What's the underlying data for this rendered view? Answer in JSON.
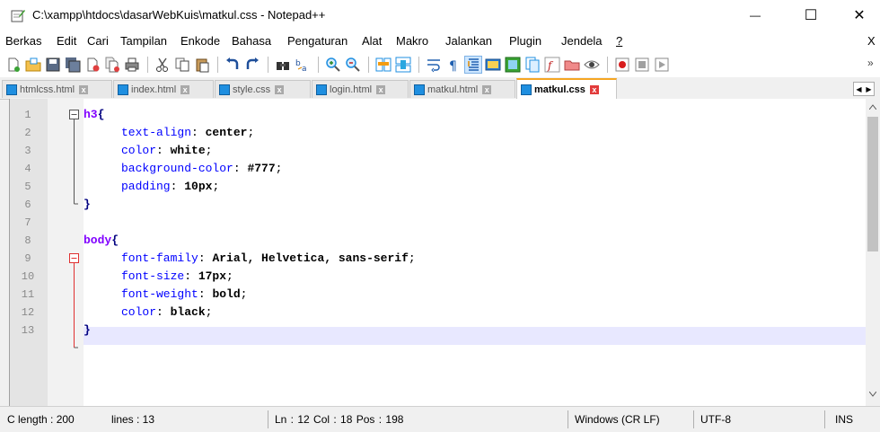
{
  "window": {
    "title": "C:\\xampp\\htdocs\\dasarWebKuis\\matkul.css - Notepad++",
    "minimize_glyph": "—",
    "maximize_glyph": "☐",
    "close_glyph": "✕"
  },
  "menu": {
    "items": [
      "Berkas",
      "Edit",
      "Cari",
      "Tampilan",
      "Enkode",
      "Bahasa",
      "Pengaturan",
      "Alat",
      "Makro",
      "Jalankan",
      "Plugin",
      "Jendela",
      "?"
    ],
    "close_doc": "X",
    "overflow": "»"
  },
  "tabs": [
    {
      "label": "htmlcss.html",
      "close": "x"
    },
    {
      "label": "index.html",
      "close": "x"
    },
    {
      "label": "style.css",
      "close": "x"
    },
    {
      "label": "login.html",
      "close": "x"
    },
    {
      "label": "matkul.html",
      "close": "x"
    },
    {
      "label": "matkul.css",
      "close": "x",
      "active": true
    }
  ],
  "editor": {
    "lines": [
      {
        "n": "1",
        "sel": "h3",
        "open": "{"
      },
      {
        "n": "2",
        "prop": "text-align",
        "val": "center"
      },
      {
        "n": "3",
        "prop": "color",
        "val": "white"
      },
      {
        "n": "4",
        "prop": "background-color",
        "val": "#777"
      },
      {
        "n": "5",
        "prop": "padding",
        "val": "10px"
      },
      {
        "n": "6",
        "close": "}"
      },
      {
        "n": "7"
      },
      {
        "n": "8",
        "sel": "body",
        "open": "{"
      },
      {
        "n": "9",
        "prop": "font-family",
        "val": "Arial, Helvetica, sans-serif"
      },
      {
        "n": "10",
        "prop": "font-size",
        "val": "17px"
      },
      {
        "n": "11",
        "prop": "font-weight",
        "val": "bold"
      },
      {
        "n": "12",
        "prop": "color",
        "val": "black"
      },
      {
        "n": "13",
        "close": "}"
      }
    ],
    "current_line": 12
  },
  "status": {
    "length": "C  length : 200",
    "lines": "lines : 13",
    "position": "Ln : 12    Col : 18    Pos : 198",
    "eol": "Windows (CR LF)",
    "encoding": "UTF-8",
    "mode": "INS"
  },
  "colors": {
    "active_tab_accent": "#f5a623",
    "current_line_bg": "#e8e8ff",
    "selector": "#8000ff",
    "property": "#0000ff"
  }
}
